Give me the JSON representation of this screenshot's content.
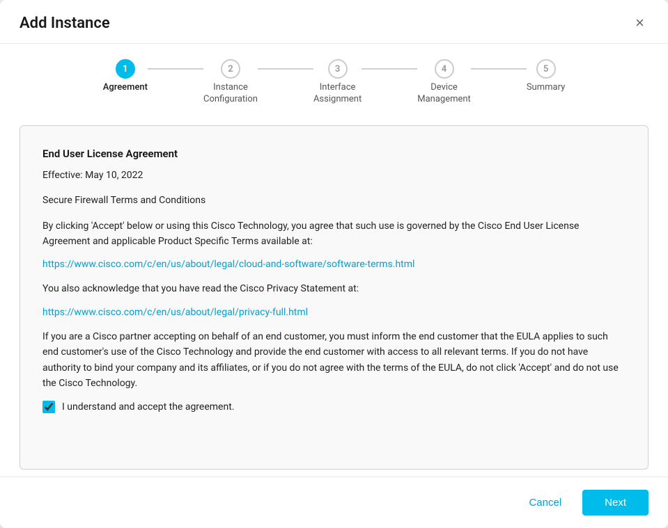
{
  "modal": {
    "title": "Add Instance",
    "close_label": "×"
  },
  "stepper": {
    "steps": [
      {
        "number": "1",
        "label": "Agreement",
        "active": true
      },
      {
        "number": "2",
        "label": "Instance Configuration",
        "active": false
      },
      {
        "number": "3",
        "label": "Interface Assignment",
        "active": false
      },
      {
        "number": "4",
        "label": "Device Management",
        "active": false
      },
      {
        "number": "5",
        "label": "Summary",
        "active": false
      }
    ]
  },
  "agreement": {
    "title": "End User License Agreement",
    "effective": "Effective: May 10, 2022",
    "subtitle": "Secure Firewall Terms and Conditions",
    "body1": "By clicking 'Accept' below or using this Cisco Technology, you agree that such use is governed by the Cisco End User License Agreement and applicable Product Specific Terms available at:",
    "link1": "https://www.cisco.com/c/en/us/about/legal/cloud-and-software/software-terms.html",
    "body2": "You also acknowledge that you have read the Cisco Privacy Statement at:",
    "link2": "https://www.cisco.com/c/en/us/about/legal/privacy-full.html",
    "body3": "If you are a Cisco partner accepting on behalf of an end customer, you must inform the end customer that the EULA applies to such end customer's use of the Cisco Technology and provide the end customer with access to all relevant terms. If you do not have authority to bind your company and its affiliates, or if you do not agree with the terms of the EULA, do not click 'Accept' and do not use the Cisco Technology.",
    "checkbox_label": "I understand and accept the agreement.",
    "checkbox_checked": true
  },
  "footer": {
    "cancel_label": "Cancel",
    "next_label": "Next"
  }
}
